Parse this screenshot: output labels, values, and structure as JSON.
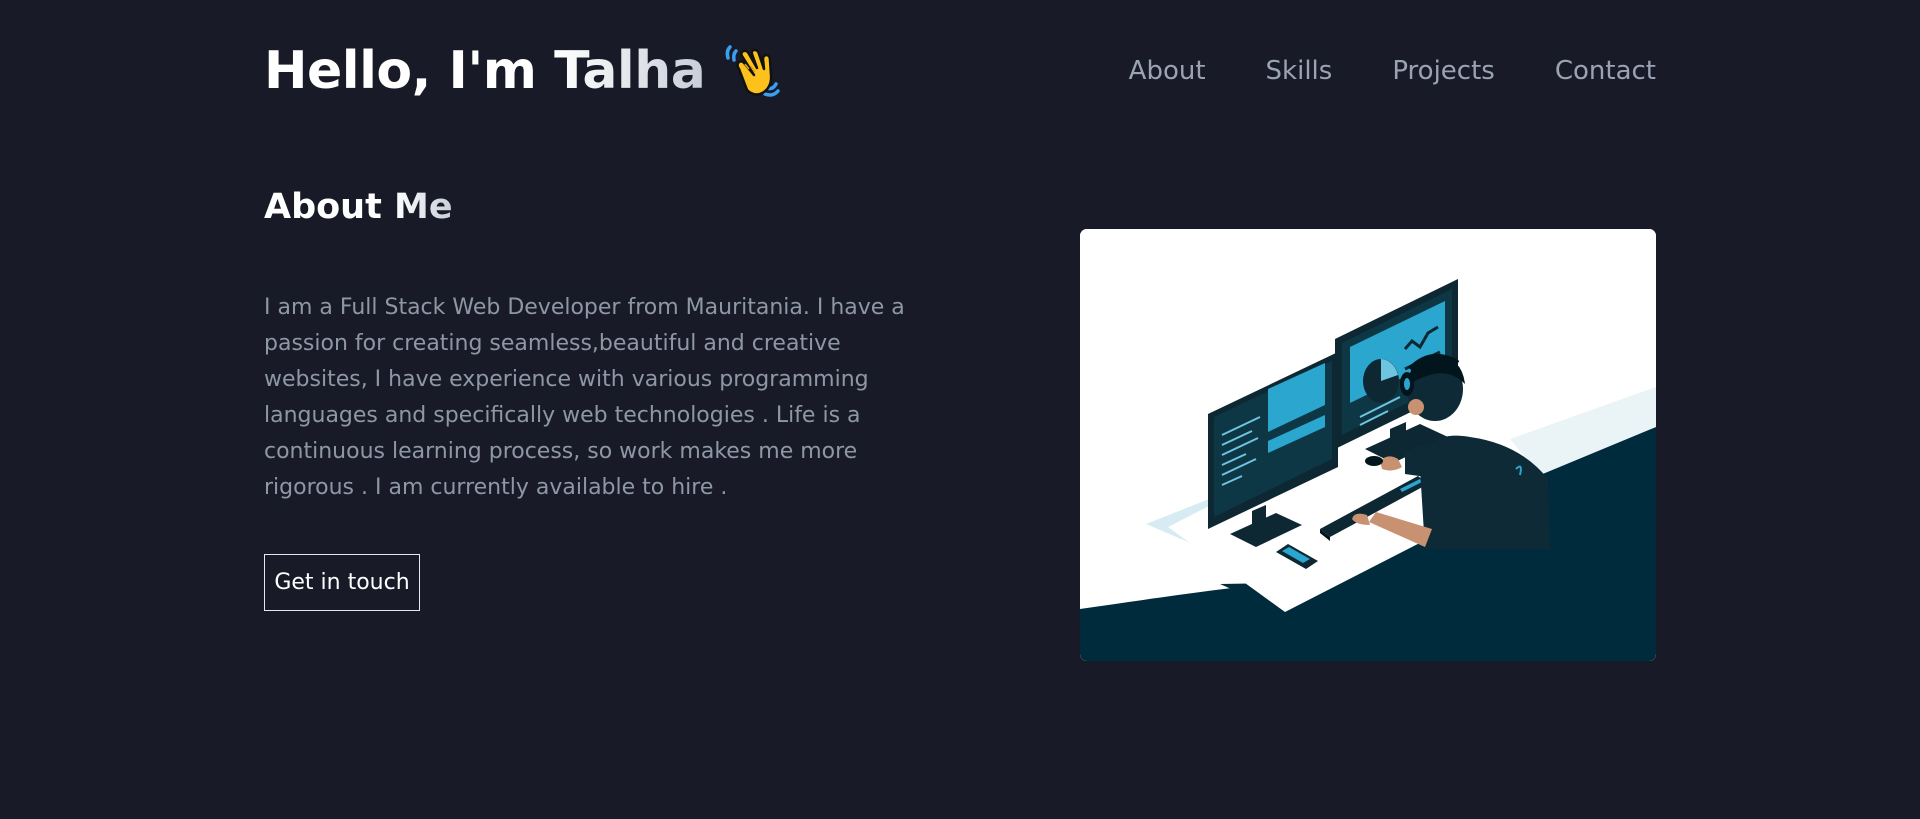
{
  "header": {
    "greeting_lead": "Hello, I'm ",
    "greeting_name": "Talha",
    "greeting_icon": "waving-hand-icon"
  },
  "nav": {
    "items": [
      {
        "label": "About"
      },
      {
        "label": "Skills"
      },
      {
        "label": "Projects"
      },
      {
        "label": "Contact"
      }
    ]
  },
  "about": {
    "title_lead": "About ",
    "title_accent": "Me",
    "paragraph": "I am a Full Stack Web Developer from Mauritania. I have a passion for creating seamless,beautiful and creative websites, I have experience with various programming languages and specifically web technologies . Life is a continuous learning process, so work makes me more rigorous . I am currently available to hire .",
    "cta_label": "Get in touch"
  },
  "theme": {
    "background": "#181b27",
    "muted_text": "#8e97a6",
    "illustration_dark": "#002b3d",
    "illustration_accent": "#2aa6cf"
  }
}
